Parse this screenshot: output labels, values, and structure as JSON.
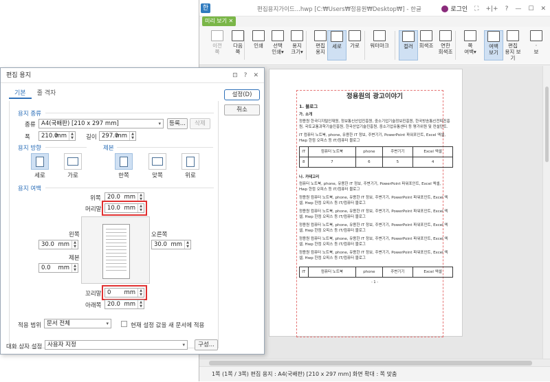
{
  "window": {
    "title": "편집용지가이드...hwp [C:₩Users₩정용원₩Desktop₩] - 한글",
    "logo": "한",
    "login": "로그인",
    "controls": [
      "⛶",
      "+|+",
      "?",
      "—",
      "☐",
      "✕"
    ]
  },
  "tab": {
    "label": "미리 보기",
    "close": "✕"
  },
  "ribbon": {
    "items": [
      {
        "name": "prev-page",
        "label": "이전\n쪽",
        "disabled": true
      },
      {
        "name": "next-page",
        "label": "다음\n쪽",
        "disabled": false
      },
      {
        "name": "print",
        "label": "인쇄",
        "disabled": false
      },
      {
        "name": "select-print",
        "label": "선택\n인쇄▾",
        "disabled": false
      },
      {
        "name": "paper-size",
        "label": "용지\n크기▾",
        "disabled": false
      },
      {
        "name": "edit-paper",
        "label": "편집\n용지",
        "disabled": false
      },
      {
        "name": "portrait",
        "label": "세로",
        "disabled": false,
        "selected": true
      },
      {
        "name": "landscape",
        "label": "가로",
        "disabled": false
      },
      {
        "name": "watermark",
        "label": "워터마크",
        "disabled": false
      },
      {
        "name": "color",
        "label": "컬러",
        "disabled": false,
        "selected": true
      },
      {
        "name": "grayscale",
        "label": "회색조",
        "disabled": false
      },
      {
        "name": "light-grayscale",
        "label": "연한\n회색조",
        "disabled": false
      },
      {
        "name": "page-margin",
        "label": "쪽\n여백▾",
        "disabled": false
      },
      {
        "name": "margin-view",
        "label": "여백\n보기",
        "disabled": false,
        "selected": true
      },
      {
        "name": "edit-paper-view",
        "label": "편집\n용지 보기",
        "disabled": false
      },
      {
        "name": "more",
        "label": "·\n보",
        "disabled": false
      }
    ]
  },
  "status": "1쪽 (1쪽 / 3쪽) 편집 용지 : A4(국배판) [210 x 297 mm] 화면 확대 : 쪽 맞춤",
  "document": {
    "title": "정용원의 광고이야기",
    "section1": "1. 블로그",
    "sub_a": "가. 소개",
    "para_a1": "정용원 한국디지털인재원, 정보통신산업진흥원, 중소기업기술정보진흥원, 한국방송통신전파진흥원, 국토교통과학기술진흥원, 한국산업기술진흥원, 중소기업유통센터 등 평가위원 및 컨설턴트.",
    "para_a2": "IT 컴퓨터 노트북, phone, 유용한 IT 정보, 주변기기, PowerPoint 파워포인트, Excel 엑셀, Hwp 한컴 오피스 등 IT/컴퓨터 블로그",
    "table1": {
      "header": [
        "IT",
        "컴퓨터 노트북",
        "phone",
        "주변기기",
        "Excel 엑셀"
      ],
      "values": [
        "8",
        "7",
        "6",
        "5",
        "4"
      ]
    },
    "sub_b": "나. 카테고리",
    "para_b1": "컴퓨터 노트북, phone, 유용한 IT 정보, 주변기기, PowerPoint 파워포인트, Excel 엑셀, Hwp 한컴 오피스 등 IT/컴퓨터 블로그",
    "para_b2": "정용원 컴퓨터 노트북, phone, 유용한 IT 정보, 주변기기, PowerPoint 파워포인트, Excel 엑셀, Hwp 한컴 오피스 등 IT/컴퓨터 블로그",
    "table2": {
      "header": [
        "IT",
        "컴퓨터 노트북",
        "phone",
        "주변기기",
        "Excel 엑셀"
      ]
    },
    "page_number": "- 1 -"
  },
  "dialog": {
    "title": "편집 용지",
    "tabs": [
      "기본",
      "줄 격자"
    ],
    "btn_ok": "설정(D)",
    "btn_cancel": "취소",
    "paper_type_section": "용지 종류",
    "type_label": "종류",
    "type_value": "A4(국배판) [210 x 297 mm]",
    "register": "등록...",
    "delete": "삭제",
    "width_label": "폭",
    "width_value": "210.0",
    "length_label": "길이",
    "length_value": "297.0",
    "unit": "mm",
    "orientation_section": "용지 방향",
    "orient_portrait": "세로",
    "orient_landscape": "가로",
    "binding_section": "제본",
    "bind_single": "한쪽",
    "bind_facing": "맞쪽",
    "bind_top": "위로",
    "margin_section": "용지 여백",
    "top_label": "위쪽",
    "top_value": "20.0",
    "header_label": "머리말",
    "header_value": "10.0",
    "left_label": "왼쪽",
    "left_value": "30.0",
    "right_label": "오른쪽",
    "right_value": "30.0",
    "gutter_label": "제본",
    "gutter_value": "0.0",
    "footer_label": "꼬리말",
    "footer_value": "0",
    "bottom_label": "아래쪽",
    "bottom_value": "20.0",
    "apply_label": "적용 범위",
    "apply_value": "문서 전체",
    "default_check": "현재 설정 값을 새 문서에 적용",
    "dialog_setting_label": "대화 상자 설정",
    "dialog_setting_value": "사용자 지정",
    "compose": "구성...",
    "title_icons": [
      "⊡",
      "?",
      "✕"
    ]
  },
  "colors": {
    "accent": "#2c6fb8",
    "highlight": "#e03030",
    "tab_green": "#7ab648"
  }
}
